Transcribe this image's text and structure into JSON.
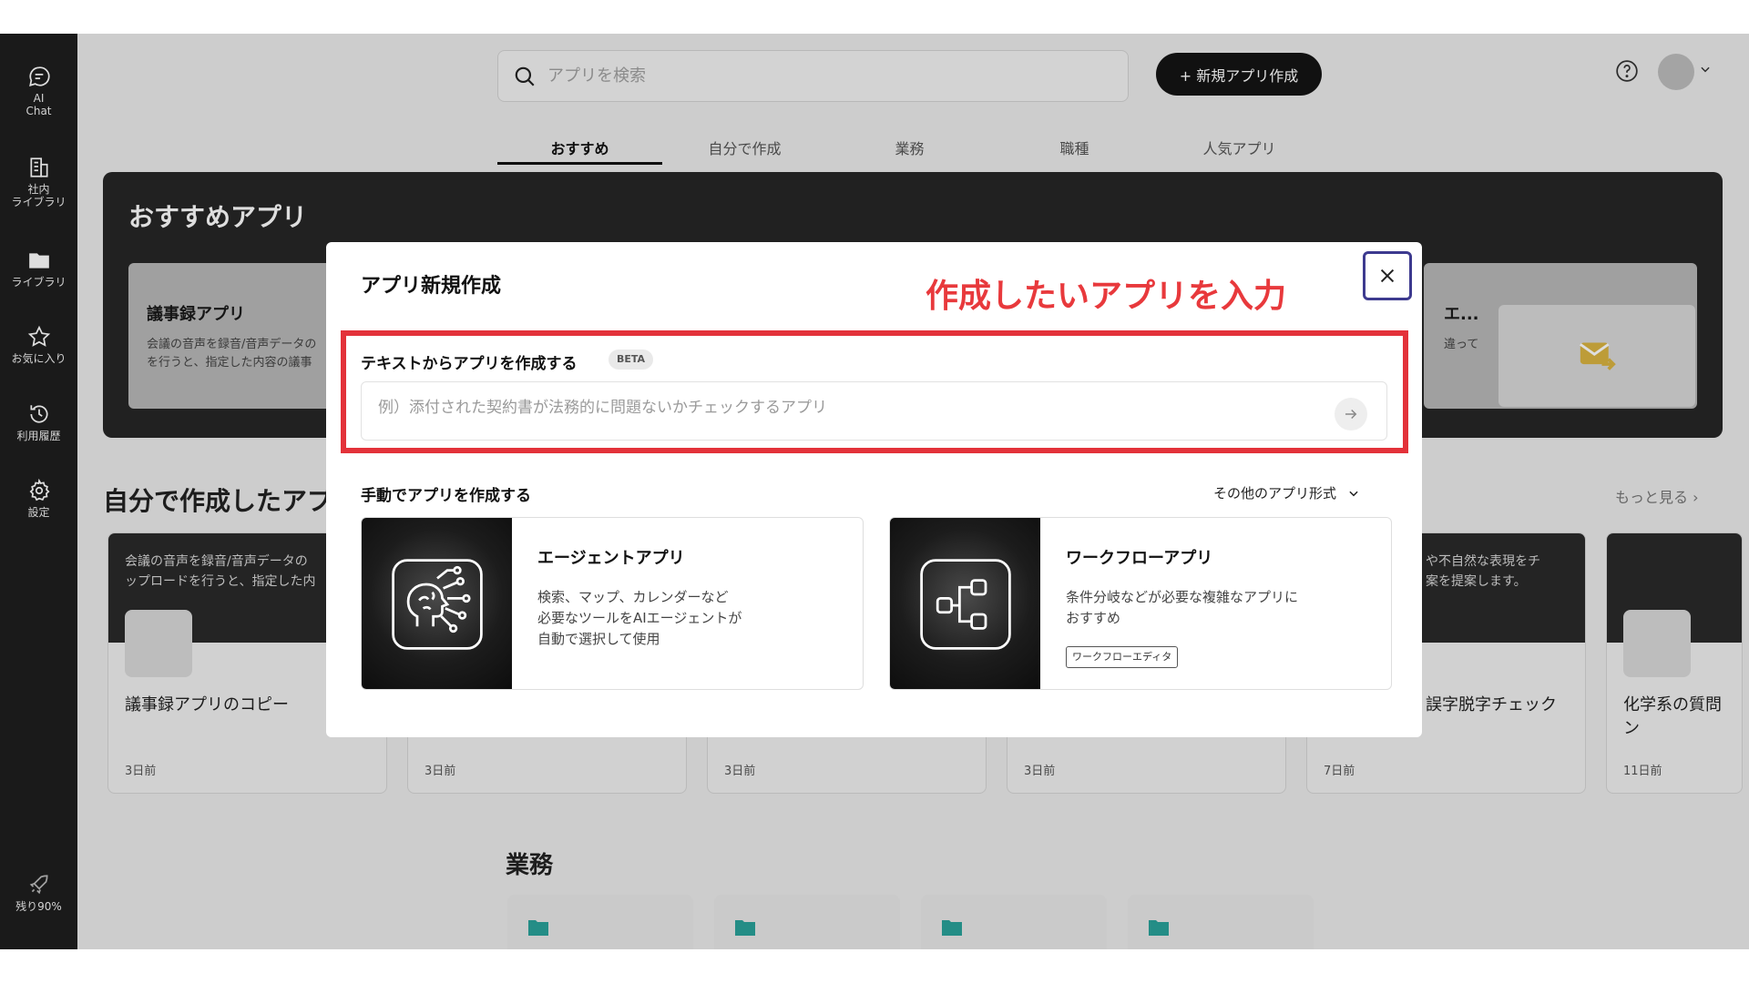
{
  "sidebar": {
    "items": [
      {
        "icon": "chat-icon",
        "label": "AI\nChat"
      },
      {
        "icon": "building-icon",
        "label": "社内\nライブラリ"
      },
      {
        "icon": "folder-icon",
        "label": "ライブラリ"
      },
      {
        "icon": "star-icon",
        "label": "お気に入り"
      },
      {
        "icon": "history-icon",
        "label": "利用履歴"
      },
      {
        "icon": "gear-icon",
        "label": "設定"
      }
    ],
    "quota_label": "残り90%"
  },
  "header": {
    "search_placeholder": "アプリを検索",
    "new_app_label": "+ 新規アプリ作成"
  },
  "tabs": [
    {
      "label": "おすすめ",
      "active": true
    },
    {
      "label": "自分で作成",
      "active": false
    },
    {
      "label": "業務",
      "active": false
    },
    {
      "label": "職種",
      "active": false
    },
    {
      "label": "人気アプリ",
      "active": false
    }
  ],
  "recommended": {
    "title": "おすすめアプリ",
    "card_title": "議事録アプリ",
    "card_desc": "会議の音声を録音/音声データの\nを行うと、指定した内容の議事",
    "card_right_title": "エ...",
    "card_right_desc": "違って"
  },
  "my_apps": {
    "title": "自分で作成したアプ",
    "more_label": "もっと見る ›",
    "cards": [
      {
        "desc": "会議の音声を録音/音声データの\nップロードを行うと、指定した内",
        "name": "議事録アプリのコピー",
        "date": "3日前"
      },
      {
        "desc": "",
        "name": "",
        "date": "3日前"
      },
      {
        "desc": "",
        "name": "",
        "date": "3日前"
      },
      {
        "desc": "",
        "name": "",
        "date": "3日前"
      },
      {
        "desc": "や不自然な表現をチ\n案を提案します。",
        "name": "誤字脱字チェック",
        "date": "7日前"
      },
      {
        "desc": "",
        "name": "化学系の質問\nン",
        "date": "11日前"
      }
    ]
  },
  "business": {
    "title": "業務"
  },
  "modal": {
    "title": "アプリ新規作成",
    "annotation": "作成したいアプリを入力",
    "text_section_label": "テキストからアプリを作成する",
    "beta_label": "BETA",
    "prompt_placeholder": "例）添付された契約書が法務的に問題ないかチェックするアプリ",
    "manual_label": "手動でアプリを作成する",
    "other_formats_label": "その他のアプリ形式",
    "options": [
      {
        "title": "エージェントアプリ",
        "desc": "検索、マップ、カレンダーなど\n必要なツールをAIエージェントが\n自動で選択して使用",
        "tag": ""
      },
      {
        "title": "ワークフローアプリ",
        "desc": "条件分岐などが必要な複雑なアプリに\nおすすめ",
        "tag": "ワークフローエディタ"
      }
    ]
  },
  "colors": {
    "sidebar_bg": "#1e1e1e",
    "accent_red": "#e3323a",
    "close_border": "#3d3a8f",
    "folder_teal": "#2aa39a",
    "mail_yellow": "#d9b441"
  }
}
